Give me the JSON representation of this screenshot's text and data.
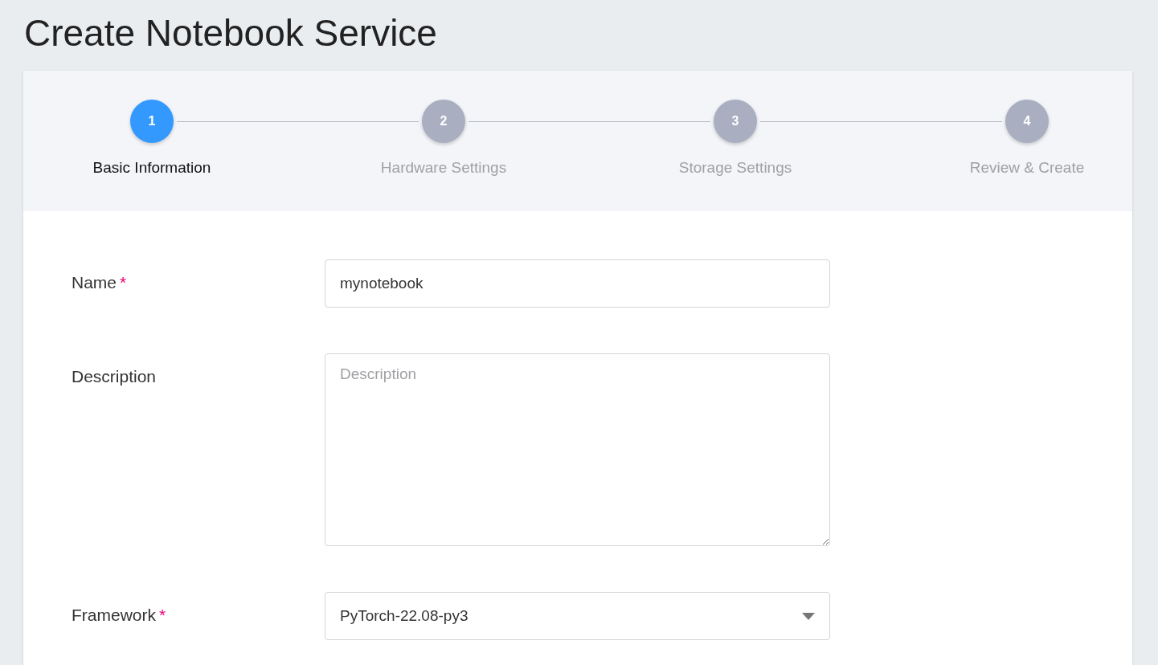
{
  "page_title": "Create Notebook Service",
  "steps": [
    {
      "number": "1",
      "label": "Basic Information",
      "selected": true
    },
    {
      "number": "2",
      "label": "Hardware Settings",
      "selected": false
    },
    {
      "number": "3",
      "label": "Storage Settings",
      "selected": false
    },
    {
      "number": "4",
      "label": "Review & Create",
      "selected": false
    }
  ],
  "fields": [
    {
      "kind": "text",
      "label": "Name",
      "required_mark": "*",
      "value": "mynotebook"
    },
    {
      "kind": "textarea",
      "label": "Description",
      "placeholder": "Description"
    },
    {
      "kind": "select",
      "label": "Framework",
      "required_mark": "*",
      "value": "PyTorch-22.08-py3"
    }
  ]
}
